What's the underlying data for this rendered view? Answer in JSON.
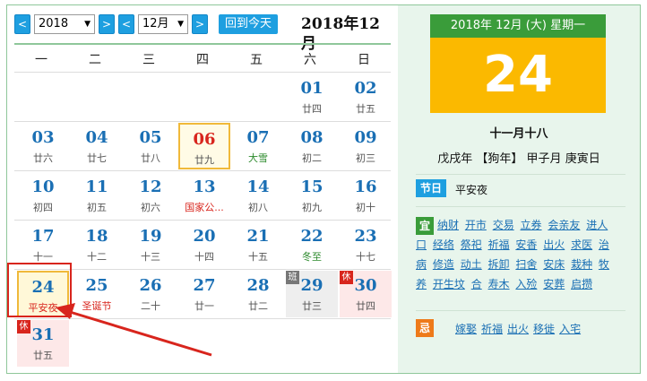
{
  "toolbar": {
    "prev_label": "<",
    "next_label": ">",
    "year_value": "2018",
    "month_value": "12月",
    "today_label": "回到今天",
    "title": "2018年12月"
  },
  "weekdays": [
    "一",
    "二",
    "三",
    "四",
    "五",
    "六",
    "日"
  ],
  "days": [
    {
      "n": "01",
      "l": "廿四",
      "row": 0,
      "col": 5
    },
    {
      "n": "02",
      "l": "廿五",
      "row": 0,
      "col": 6
    },
    {
      "n": "03",
      "l": "廿六",
      "row": 1,
      "col": 0
    },
    {
      "n": "04",
      "l": "廿七",
      "row": 1,
      "col": 1
    },
    {
      "n": "05",
      "l": "廿八",
      "row": 1,
      "col": 2
    },
    {
      "n": "06",
      "l": "廿九",
      "row": 1,
      "col": 3,
      "state": "today"
    },
    {
      "n": "07",
      "l": "大雪",
      "row": 1,
      "col": 4,
      "lstyle": "green"
    },
    {
      "n": "08",
      "l": "初二",
      "row": 1,
      "col": 5
    },
    {
      "n": "09",
      "l": "初三",
      "row": 1,
      "col": 6
    },
    {
      "n": "10",
      "l": "初四",
      "row": 2,
      "col": 0
    },
    {
      "n": "11",
      "l": "初五",
      "row": 2,
      "col": 1
    },
    {
      "n": "12",
      "l": "初六",
      "row": 2,
      "col": 2
    },
    {
      "n": "13",
      "l": "国家公...",
      "row": 2,
      "col": 3,
      "lstyle": "red"
    },
    {
      "n": "14",
      "l": "初八",
      "row": 2,
      "col": 4
    },
    {
      "n": "15",
      "l": "初九",
      "row": 2,
      "col": 5
    },
    {
      "n": "16",
      "l": "初十",
      "row": 2,
      "col": 6
    },
    {
      "n": "17",
      "l": "十一",
      "row": 3,
      "col": 0
    },
    {
      "n": "18",
      "l": "十二",
      "row": 3,
      "col": 1
    },
    {
      "n": "19",
      "l": "十三",
      "row": 3,
      "col": 2
    },
    {
      "n": "20",
      "l": "十四",
      "row": 3,
      "col": 3
    },
    {
      "n": "21",
      "l": "十五",
      "row": 3,
      "col": 4
    },
    {
      "n": "22",
      "l": "冬至",
      "row": 3,
      "col": 5,
      "lstyle": "green"
    },
    {
      "n": "23",
      "l": "十七",
      "row": 3,
      "col": 6
    },
    {
      "n": "24",
      "l": "平安夜",
      "row": 4,
      "col": 0,
      "state": "selected",
      "lstyle": "red"
    },
    {
      "n": "25",
      "l": "圣诞节",
      "row": 4,
      "col": 1,
      "lstyle": "red"
    },
    {
      "n": "26",
      "l": "二十",
      "row": 4,
      "col": 2
    },
    {
      "n": "27",
      "l": "廿一",
      "row": 4,
      "col": 3
    },
    {
      "n": "28",
      "l": "廿二",
      "row": 4,
      "col": 4
    },
    {
      "n": "29",
      "l": "廿三",
      "row": 4,
      "col": 5,
      "state": "work",
      "tag": "班"
    },
    {
      "n": "30",
      "l": "廿四",
      "row": 4,
      "col": 6,
      "state": "rest",
      "tag": "休"
    },
    {
      "n": "31",
      "l": "廿五",
      "row": 5,
      "col": 0,
      "state": "rest",
      "tag": "休"
    }
  ],
  "detail": {
    "header": "2018年 12月 (大) 星期一",
    "day": "24",
    "lunar": "十一月十八",
    "ganzhi": "戊戌年 【狗年】 甲子月 庚寅日",
    "festival_badge": "节日",
    "festival": "平安夜",
    "yi_badge": "宜",
    "yi": [
      "纳财",
      "开市",
      "交易",
      "立券",
      "会亲友",
      "进人口",
      "经络",
      "祭祀",
      "祈福",
      "安香",
      "出火",
      "求医",
      "治病",
      "修造",
      "动土",
      "拆卸",
      "扫舍",
      "安床",
      "栽种",
      "牧养",
      "开生坟",
      "合",
      "寿木",
      "入殓",
      "安葬",
      "启攒"
    ],
    "ji_badge": "忌",
    "ji": [
      "嫁娶",
      "祈福",
      "出火",
      "移徙",
      "入宅"
    ]
  },
  "colors": {
    "accent_blue": "#1e9fe0",
    "day_blue": "#1a6fb4",
    "green": "#3a9c3a",
    "gold": "#fbb900",
    "red": "#d8251d"
  }
}
